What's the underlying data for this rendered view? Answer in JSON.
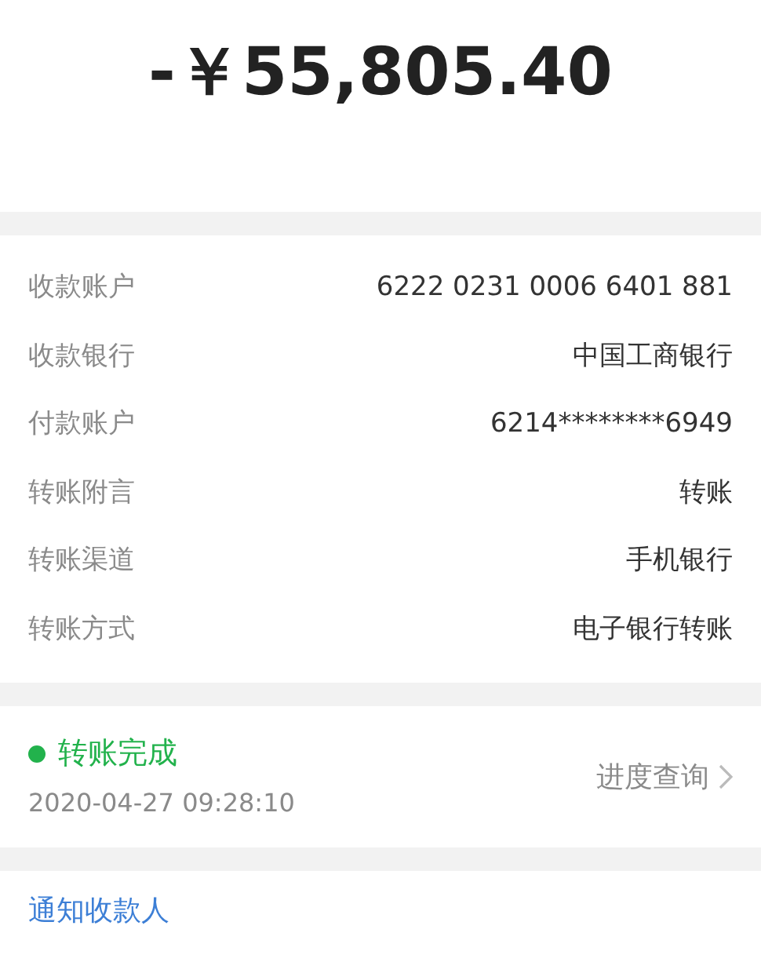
{
  "amount": "-￥55,805.40",
  "details": [
    {
      "label": "收款账户",
      "value": "6222 0231 0006 6401 881"
    },
    {
      "label": "收款银行",
      "value": "中国工商银行"
    },
    {
      "label": "付款账户",
      "value": "6214********6949"
    },
    {
      "label": "转账附言",
      "value": "转账"
    },
    {
      "label": "转账渠道",
      "value": "手机银行"
    },
    {
      "label": "转账方式",
      "value": "电子银行转账"
    }
  ],
  "status": {
    "text": "转账完成",
    "color": "#22b24c",
    "time": "2020-04-27 09:28:10",
    "link": "进度查询"
  },
  "notify_link": "通知收款人"
}
